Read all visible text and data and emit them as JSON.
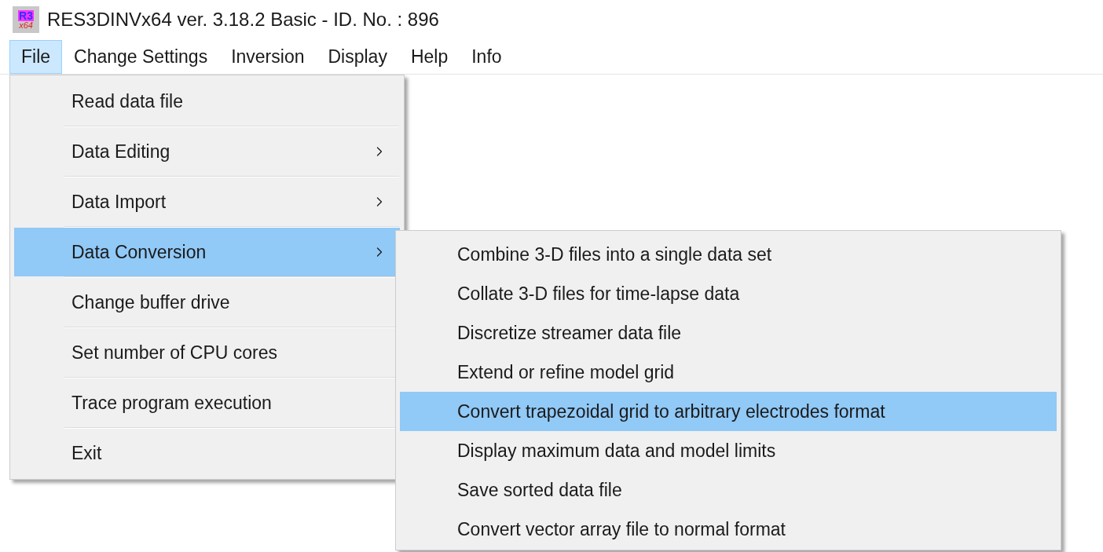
{
  "window": {
    "title": "RES3DINVx64 ver. 3.18.2 Basic - ID. No. : 896",
    "logo_text": [
      "R3",
      "x64"
    ]
  },
  "menu_bar": [
    {
      "label": "File",
      "selected": true
    },
    {
      "label": "Change Settings",
      "selected": false
    },
    {
      "label": "Inversion",
      "selected": false
    },
    {
      "label": "Display",
      "selected": false
    },
    {
      "label": "Help",
      "selected": false
    },
    {
      "label": "Info",
      "selected": false
    }
  ],
  "file_menu": [
    {
      "label": "Read data file",
      "has_submenu": false,
      "selected": false
    },
    {
      "label": "Data Editing",
      "has_submenu": true,
      "selected": false
    },
    {
      "label": "Data Import",
      "has_submenu": true,
      "selected": false
    },
    {
      "label": "Data Conversion",
      "has_submenu": true,
      "selected": true
    },
    {
      "label": "Change buffer drive",
      "has_submenu": false,
      "selected": false
    },
    {
      "label": "Set number of CPU cores",
      "has_submenu": false,
      "selected": false
    },
    {
      "label": "Trace program execution",
      "has_submenu": false,
      "selected": false
    },
    {
      "label": "Exit",
      "has_submenu": false,
      "selected": false
    }
  ],
  "submenu": [
    {
      "label": "Combine 3-D files into a single data set",
      "selected": false
    },
    {
      "label": "Collate 3-D files for time-lapse data",
      "selected": false
    },
    {
      "label": "Discretize streamer data file",
      "selected": false
    },
    {
      "label": "Extend or refine model grid",
      "selected": false
    },
    {
      "label": "Convert trapezoidal grid to arbitrary electrodes format",
      "selected": true
    },
    {
      "label": "Display maximum data and model limits",
      "selected": false
    },
    {
      "label": "Save sorted data file",
      "selected": false
    },
    {
      "label": "Convert vector array file to normal format",
      "selected": false
    }
  ]
}
